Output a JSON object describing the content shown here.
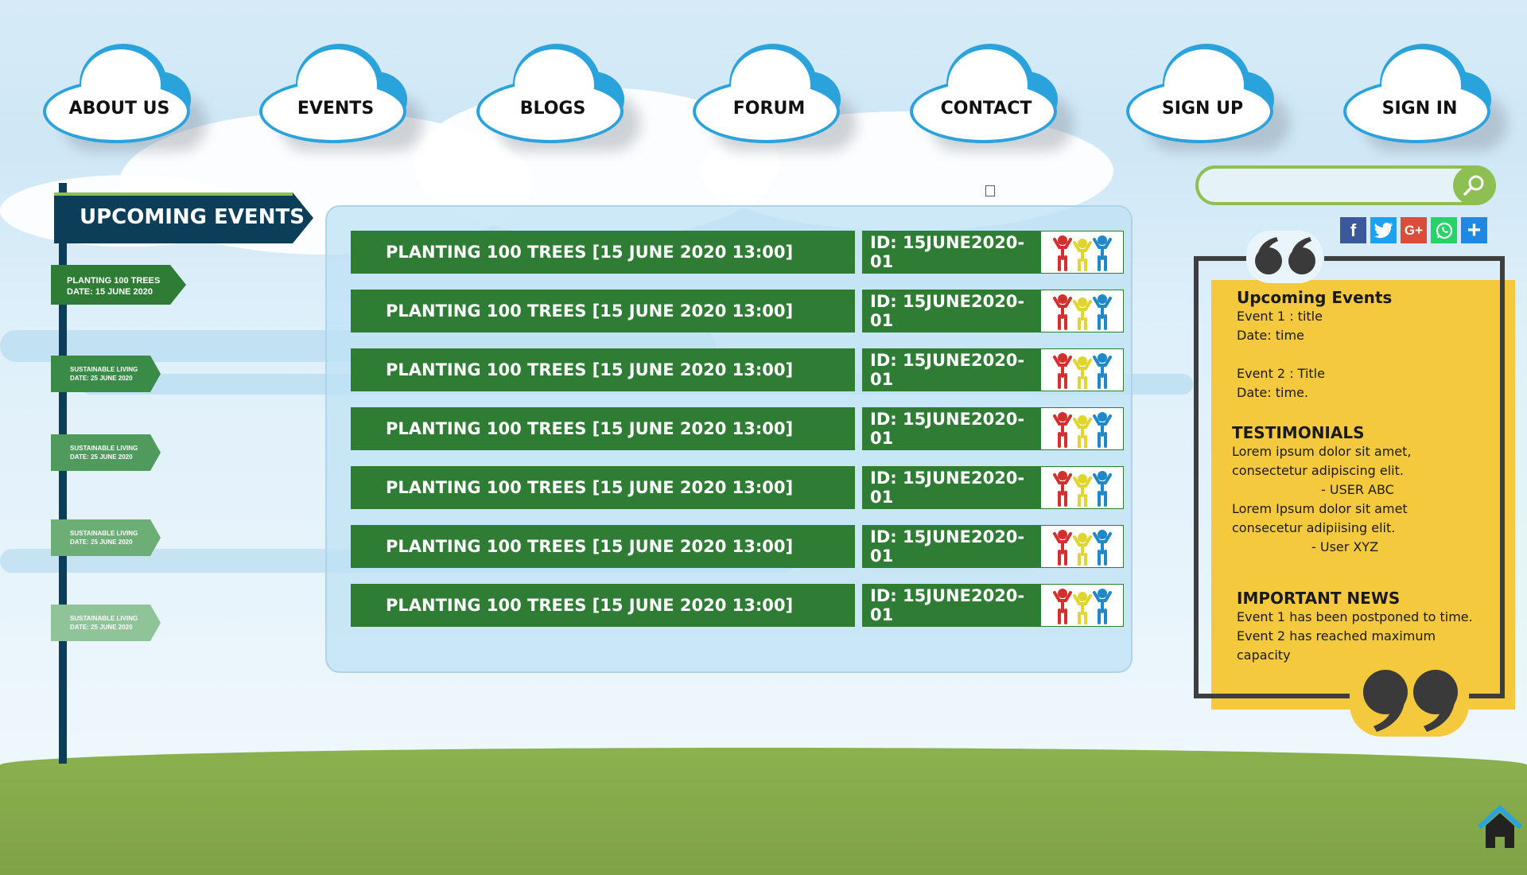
{
  "nav": {
    "items": [
      {
        "label": "ABOUT US"
      },
      {
        "label": "EVENTS"
      },
      {
        "label": "BLOGS"
      },
      {
        "label": "FORUM"
      },
      {
        "label": "CONTACT"
      },
      {
        "label": "SIGN UP"
      },
      {
        "label": "SIGN IN"
      }
    ]
  },
  "search": {
    "placeholder": "",
    "icon": "search-icon"
  },
  "social": [
    {
      "name": "facebook-icon",
      "glyph": "f",
      "color": "#3b5998"
    },
    {
      "name": "twitter-icon",
      "glyph": "t",
      "color": "#1da1f2"
    },
    {
      "name": "google-plus-icon",
      "glyph": "G+",
      "color": "#dd4b39"
    },
    {
      "name": "whatsapp-icon",
      "glyph": "w",
      "color": "#25d366"
    },
    {
      "name": "share-plus-icon",
      "glyph": "+",
      "color": "#1e88e5"
    }
  ],
  "timeline": {
    "title": "UPCOMING EVENTS",
    "signs": [
      {
        "line1": "PLANTING 100 TREES",
        "line2": "DATE: 15 JUNE 2020"
      },
      {
        "line1": "SUSTAINABLE LIVING",
        "line2": "DATE: 25 JUNE 2020"
      },
      {
        "line1": "SUSTAINABLE LIVING",
        "line2": "DATE: 25 JUNE 2020"
      },
      {
        "line1": "SUSTAINABLE LIVING",
        "line2": "DATE: 25 JUNE 2020"
      },
      {
        "line1": "SUSTAINABLE LIVING",
        "line2": "DATE: 25 JUNE 2020"
      }
    ]
  },
  "events": [
    {
      "title": "PLANTING 100 TREES [15 JUNE 2020 13:00]",
      "id": "ID: 15JUNE2020-01"
    },
    {
      "title": "PLANTING 100 TREES [15 JUNE 2020 13:00]",
      "id": "ID: 15JUNE2020-01"
    },
    {
      "title": "PLANTING 100 TREES [15 JUNE 2020 13:00]",
      "id": "ID: 15JUNE2020-01"
    },
    {
      "title": "PLANTING 100 TREES [15 JUNE 2020 13:00]",
      "id": "ID: 15JUNE2020-01"
    },
    {
      "title": "PLANTING 100 TREES [15 JUNE 2020 13:00]",
      "id": "ID: 15JUNE2020-01"
    },
    {
      "title": "PLANTING 100 TREES [15 JUNE 2020 13:00]",
      "id": "ID: 15JUNE2020-01"
    },
    {
      "title": "PLANTING 100 TREES [15 JUNE 2020 13:00]",
      "id": "ID: 15JUNE2020-01"
    }
  ],
  "sidebar": {
    "upcoming_title": "Upcoming Events",
    "event1_title": "Event 1 : title",
    "event1_date": "Date: time",
    "event2_title": "Event 2 : Title",
    "event2_date": "Date: time.",
    "testimonials_title": "TESTIMONIALS",
    "t1_line1": "Lorem ipsum dolor sit amet,",
    "t1_line2": "consectetur adipiscing elit.",
    "t1_author": "- USER ABC",
    "t2_line1": "Lorem Ipsum dolor sit amet",
    "t2_line2": "consecetur adipiising elit.",
    "t2_author": "- User XYZ",
    "news_title": "IMPORTANT NEWS",
    "news1": "Event 1 has been postponed to time.",
    "news2": "Event 2 has reached maximum",
    "news3": "capacity"
  },
  "colors": {
    "event_green": "#2f7d35",
    "nav_blue": "#2aa2dc",
    "timeline_navy": "#0c3e5a",
    "sidebar_yellow": "#f4c93e",
    "grass": "#8bb14f"
  }
}
